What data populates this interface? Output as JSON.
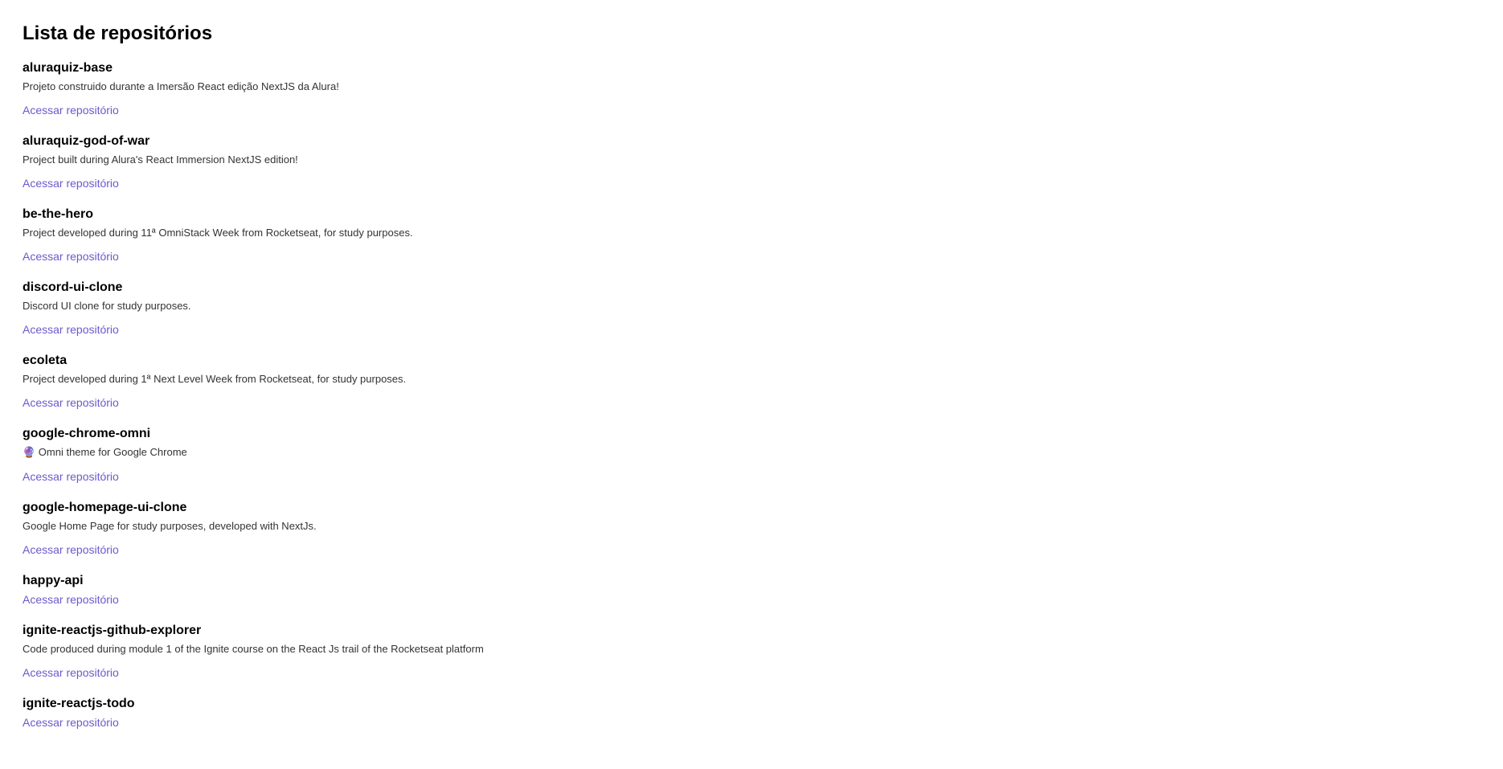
{
  "page_title": "Lista de repositórios",
  "link_label": "Acessar repositório",
  "repos": [
    {
      "name": "aluraquiz-base",
      "description": "Projeto construido durante a Imersão React edição NextJS da Alura!"
    },
    {
      "name": "aluraquiz-god-of-war",
      "description": "Project built during Alura's React Immersion NextJS edition!"
    },
    {
      "name": "be-the-hero",
      "description": "Project developed during 11ª OmniStack Week from Rocketseat, for study purposes."
    },
    {
      "name": "discord-ui-clone",
      "description": "Discord UI clone for study purposes."
    },
    {
      "name": "ecoleta",
      "description": "Project developed during 1ª Next Level Week from Rocketseat, for study purposes."
    },
    {
      "name": "google-chrome-omni",
      "description": "🔮 Omni theme for Google Chrome"
    },
    {
      "name": "google-homepage-ui-clone",
      "description": "Google Home Page for study purposes, developed with NextJs."
    },
    {
      "name": "happy-api",
      "description": ""
    },
    {
      "name": "ignite-reactjs-github-explorer",
      "description": "Code produced during module 1 of the Ignite course on the React Js trail of the Rocketseat platform"
    },
    {
      "name": "ignite-reactjs-todo",
      "description": ""
    }
  ]
}
